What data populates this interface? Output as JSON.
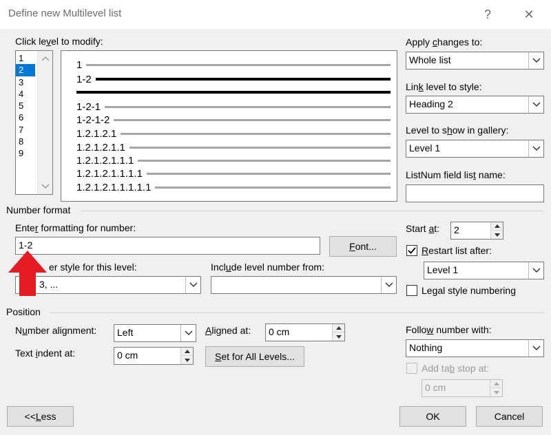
{
  "window": {
    "title": "Define new Multilevel list",
    "help": "?",
    "close": "✕"
  },
  "levels": {
    "label_pre": "Click le",
    "label_u": "v",
    "label_post": "el to modify:",
    "items": [
      "1",
      "2",
      "3",
      "4",
      "5",
      "6",
      "7",
      "8",
      "9"
    ],
    "selected": "2"
  },
  "preview": {
    "rows": [
      "1",
      "1-2",
      "",
      "1-2-1",
      "1-2-1-2",
      "1.2.1.2.1",
      "1.2.1.2.1.1",
      "1.2.1.2.1.1.1",
      "1.2.1.2.1.1.1.1",
      "1.2.1.2.1.1.1.1.1"
    ]
  },
  "apply_changes": {
    "label_pre": "Apply ",
    "label_u": "c",
    "label_post": "hanges to:",
    "value": "Whole list"
  },
  "link_level": {
    "label_pre": "Lin",
    "label_u": "k",
    "label_post": " level to style:",
    "value": "Heading 2"
  },
  "gallery_level": {
    "label_pre": "Level to s",
    "label_u": "h",
    "label_post": "ow in gallery:",
    "value": "Level 1"
  },
  "listnum": {
    "label_pre": "ListNum field lis",
    "label_u": "t",
    "label_post": " name:",
    "value": ""
  },
  "number_format": {
    "section": "Number format",
    "enter_label_pre": "Ente",
    "enter_label_u": "r",
    "enter_label_post": " formatting for number:",
    "value": "1-2",
    "font_button_pre": "",
    "font_button_u": "F",
    "font_button_post": "ont...",
    "style_label_visible": "er style for this level:",
    "style_value_visible": "3, ...",
    "include_label_pre": "Incl",
    "include_label_u": "u",
    "include_label_post": "de level number from:",
    "include_value": ""
  },
  "start_at": {
    "label_pre": "Start ",
    "label_u": "a",
    "label_post": "t:",
    "value": "2"
  },
  "restart": {
    "checked": true,
    "label_pre": "",
    "label_u": "R",
    "label_post": "estart list after:",
    "value": "Level 1"
  },
  "legal": {
    "checked": false,
    "label_pre": "Le",
    "label_u": "g",
    "label_post": "al style numbering"
  },
  "position": {
    "section": "Position",
    "alignment_label_pre": "N",
    "alignment_label_u": "u",
    "alignment_label_post": "mber alignment:",
    "alignment_value": "Left",
    "aligned_at_label_pre": "",
    "aligned_at_label_u": "A",
    "aligned_at_label_post": "ligned at:",
    "aligned_at_value": "0 cm",
    "indent_label_pre": "Text ",
    "indent_label_u": "i",
    "indent_label_post": "ndent at:",
    "indent_value": "0 cm",
    "set_all_pre": "",
    "set_all_u": "S",
    "set_all_post": "et for All Levels..."
  },
  "follow": {
    "label_pre": "Follo",
    "label_u": "w",
    "label_post": " number with:",
    "value": "Nothing"
  },
  "tabstop": {
    "checked": false,
    "label_pre": "Add ta",
    "label_u": "b",
    "label_post": " stop at:",
    "value": "0 cm"
  },
  "buttons": {
    "less_pre": "<< ",
    "less_u": "L",
    "less_post": "ess",
    "ok": "OK",
    "cancel": "Cancel"
  },
  "colors": {
    "annotation_arrow": "#e31b23",
    "selection": "#0078d7"
  }
}
